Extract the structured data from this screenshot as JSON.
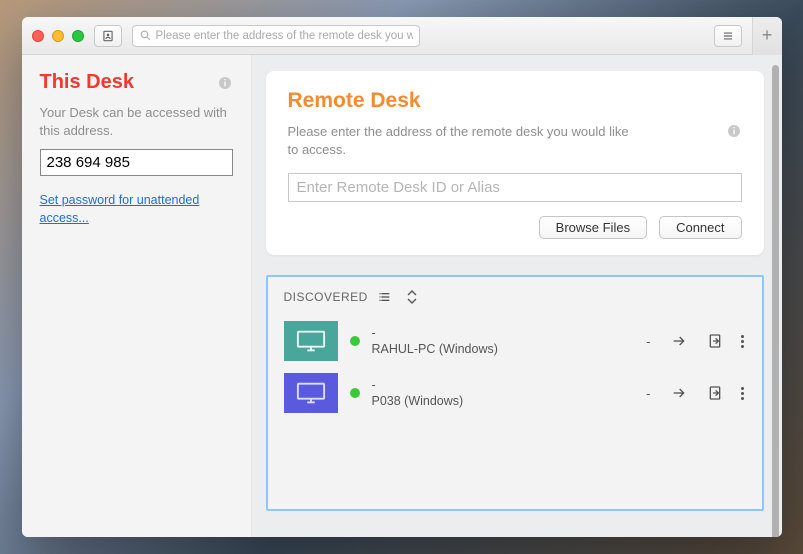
{
  "toolbar": {
    "search_placeholder": "Please enter the address of the remote desk you would like to access."
  },
  "sidebar": {
    "title": "This Desk",
    "desc": "Your Desk can be accessed with this address.",
    "address": "238 694 985",
    "password_link": "Set password for unattended access..."
  },
  "remote": {
    "title": "Remote Desk",
    "desc": "Please enter the address of the remote desk you would like to access.",
    "placeholder": "Enter Remote Desk ID or Alias",
    "browse": "Browse Files",
    "connect": "Connect"
  },
  "discovered": {
    "heading": "DISCOVERED",
    "items": [
      {
        "alias": "-",
        "host": "RAHUL-PC (Windows)",
        "right_dash": "-",
        "thumb": "green"
      },
      {
        "alias": "-",
        "host": "P038 (Windows)",
        "right_dash": "-",
        "thumb": "blue"
      }
    ]
  }
}
